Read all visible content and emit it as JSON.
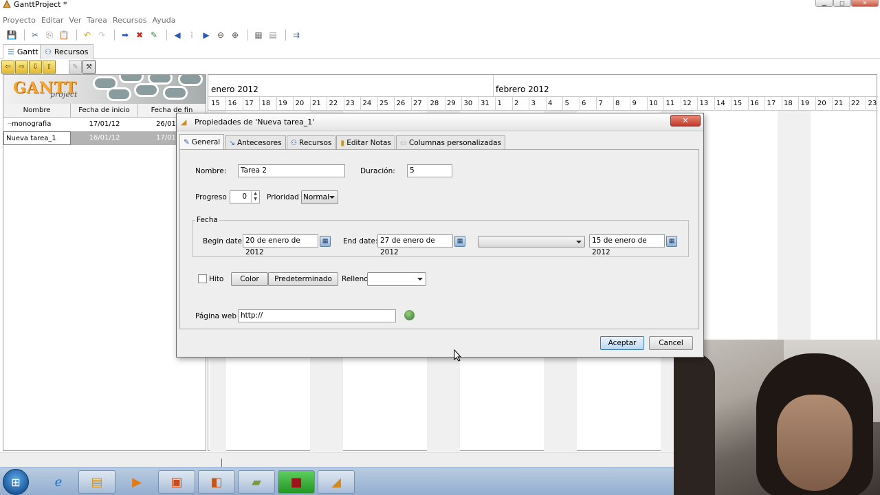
{
  "window": {
    "title": "GanttProject *"
  },
  "menu": [
    "Proyecto",
    "Editar",
    "Ver",
    "Tarea",
    "Recursos",
    "Ayuda"
  ],
  "main_tabs": [
    {
      "label": "Gantt"
    },
    {
      "label": "Recursos"
    }
  ],
  "logo": {
    "brand": "GANTT",
    "sub": "project"
  },
  "table": {
    "headers": [
      "Nombre",
      "Fecha de inicio",
      "Fecha de fin"
    ],
    "rows": [
      {
        "name": "monografia",
        "start": "17/01/12",
        "end": "26/01"
      },
      {
        "name": "Nueva tarea_1",
        "start": "16/01/12",
        "end": "17/01"
      }
    ]
  },
  "chart": {
    "months": [
      "enero 2012",
      "febrero 2012"
    ],
    "days": [
      "15",
      "16",
      "17",
      "18",
      "19",
      "20",
      "21",
      "22",
      "23",
      "24",
      "25",
      "26",
      "27",
      "28",
      "29",
      "30",
      "31",
      "1",
      "2",
      "3",
      "4",
      "5",
      "6",
      "7",
      "8",
      "9",
      "10",
      "11",
      "12",
      "13",
      "14",
      "15",
      "16",
      "17",
      "18",
      "19",
      "20",
      "21",
      "22",
      "23"
    ]
  },
  "dialog": {
    "title": "Propiedades de 'Nueva tarea_1'",
    "close_label": "✕",
    "tabs": [
      {
        "label": "General"
      },
      {
        "label": "Antecesores"
      },
      {
        "label": "Recursos"
      },
      {
        "label": "Editar Notas"
      },
      {
        "label": "Columnas personalizadas"
      }
    ],
    "nombre_label": "Nombre:",
    "nombre_value": "Tarea 2",
    "duracion_label": "Duración:",
    "duracion_value": "5",
    "progreso_label": "Progreso",
    "progreso_value": "0",
    "prioridad_label": "Prioridad",
    "prioridad_value": "Normal",
    "fecha_label": "Fecha",
    "begin_label": "Begin date:",
    "begin_value": "20 de enero de 2012",
    "end_label": "End date:",
    "end_value": "27 de enero de 2012",
    "third_date_value": "15 de enero de 2012",
    "hito_label": "Hito",
    "color_label": "Color",
    "predeterminado_label": "Predeterminado",
    "relleno_label": "Relleno",
    "pagina_label": "Página web",
    "pagina_value": "http://",
    "aceptar_label": "Aceptar",
    "cancel_label": "Cancel"
  }
}
